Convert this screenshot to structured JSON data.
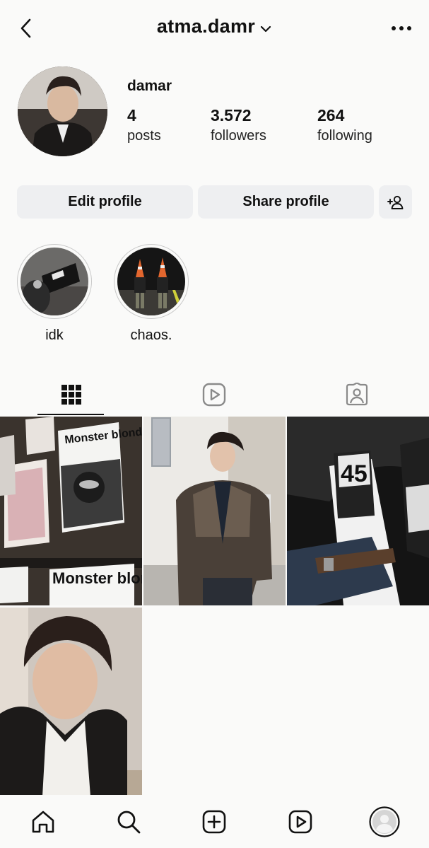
{
  "header": {
    "username": "atma.damr"
  },
  "profile": {
    "display_name": "damar",
    "stats": [
      {
        "value": "4",
        "label": "posts"
      },
      {
        "value": "3.572",
        "label": "followers"
      },
      {
        "value": "264",
        "label": "following"
      }
    ]
  },
  "actions": {
    "edit_label": "Edit profile",
    "share_label": "Share profile"
  },
  "highlights": [
    {
      "label": "idk"
    },
    {
      "label": "chaos."
    }
  ],
  "tabs": [
    {
      "icon": "grid-icon",
      "active": true
    },
    {
      "icon": "reels-icon",
      "active": false
    },
    {
      "icon": "tagged-icon",
      "active": false
    }
  ],
  "posts": [
    {
      "type": "photo",
      "subject": "Monster blondie magazine display"
    },
    {
      "type": "photo",
      "subject": "person in leather jacket"
    },
    {
      "type": "photo",
      "subject": "leather jacket close-up"
    },
    {
      "type": "photo",
      "subject": "selfie"
    }
  ],
  "magazine_text": "Monster blondie",
  "nav": [
    "home-icon",
    "search-icon",
    "create-icon",
    "reels-icon",
    "profile-avatar"
  ],
  "colors": {
    "background": "#fafaf9",
    "button": "#eeeff1",
    "text": "#111111"
  }
}
